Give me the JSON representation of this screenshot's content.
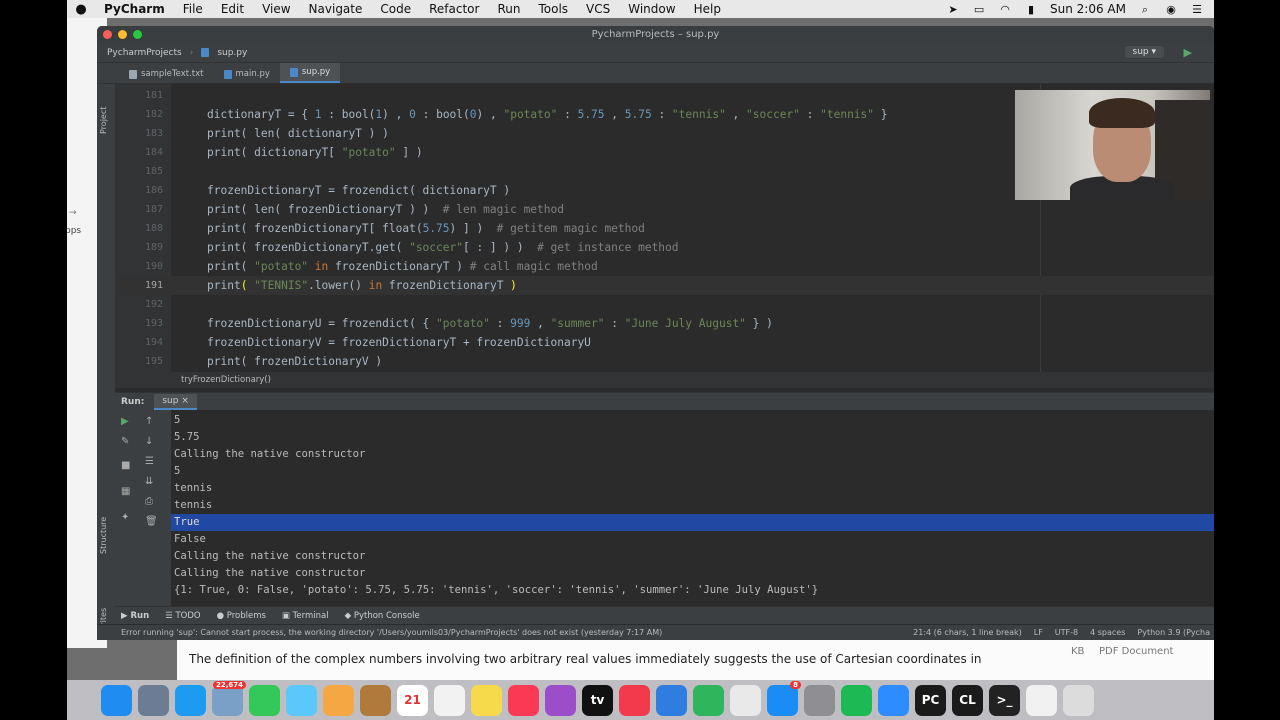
{
  "menubar": {
    "apple": "",
    "app": "PyCharm",
    "items": [
      "File",
      "Edit",
      "View",
      "Navigate",
      "Code",
      "Refactor",
      "Run",
      "Tools",
      "VCS",
      "Window",
      "Help"
    ],
    "clock": "Sun 2:06 AM"
  },
  "bg_browser": {
    "text1": "",
    "text2": "pps"
  },
  "window": {
    "title": "PycharmProjects – sup.py"
  },
  "navbar": {
    "project": "PycharmProjects",
    "file": "sup.py",
    "run_config": "sup"
  },
  "tabs": [
    {
      "label": "sampleText.txt",
      "color": "#9aa7b0"
    },
    {
      "label": "main.py",
      "color": "#4a88c7"
    },
    {
      "label": "sup.py",
      "color": "#4a88c7"
    }
  ],
  "side_labels": {
    "project": "Project",
    "structure": "Structure",
    "favorites": "Favorites"
  },
  "editor": {
    "lines": [
      {
        "n": "181",
        "code": [
          {
            "t": "",
            "c": ""
          }
        ]
      },
      {
        "n": "182",
        "code": [
          {
            "t": "dictionaryT = { ",
            "c": ""
          },
          {
            "t": "1",
            "c": "num"
          },
          {
            "t": " : bool(",
            "c": ""
          },
          {
            "t": "1",
            "c": "num"
          },
          {
            "t": ") , ",
            "c": ""
          },
          {
            "t": "0",
            "c": "num"
          },
          {
            "t": " : bool(",
            "c": ""
          },
          {
            "t": "0",
            "c": "num"
          },
          {
            "t": ") , ",
            "c": ""
          },
          {
            "t": "\"potato\"",
            "c": "str"
          },
          {
            "t": " : ",
            "c": ""
          },
          {
            "t": "5.75",
            "c": "num"
          },
          {
            "t": " , ",
            "c": ""
          },
          {
            "t": "5.75",
            "c": "num"
          },
          {
            "t": " : ",
            "c": ""
          },
          {
            "t": "\"tennis\"",
            "c": "str"
          },
          {
            "t": " , ",
            "c": ""
          },
          {
            "t": "\"soccer\"",
            "c": "str"
          },
          {
            "t": " : ",
            "c": ""
          },
          {
            "t": "\"tennis\"",
            "c": "str"
          },
          {
            "t": " }",
            "c": ""
          }
        ]
      },
      {
        "n": "183",
        "code": [
          {
            "t": "print( len( dictionaryT ) )",
            "c": ""
          }
        ]
      },
      {
        "n": "184",
        "code": [
          {
            "t": "print( dictionaryT[ ",
            "c": ""
          },
          {
            "t": "\"potato\"",
            "c": "str"
          },
          {
            "t": " ] )",
            "c": ""
          }
        ]
      },
      {
        "n": "185",
        "code": [
          {
            "t": "",
            "c": ""
          }
        ]
      },
      {
        "n": "186",
        "code": [
          {
            "t": "frozenDictionaryT = frozendict( dictionaryT )",
            "c": ""
          }
        ]
      },
      {
        "n": "187",
        "code": [
          {
            "t": "print( len( frozenDictionaryT ) )  ",
            "c": ""
          },
          {
            "t": "# len magic method",
            "c": "com"
          }
        ]
      },
      {
        "n": "188",
        "code": [
          {
            "t": "print( frozenDictionaryT[ ",
            "c": ""
          },
          {
            "t": "float",
            "c": "fn"
          },
          {
            "t": "(",
            "c": ""
          },
          {
            "t": "5.75",
            "c": "num"
          },
          {
            "t": ") ] )  ",
            "c": ""
          },
          {
            "t": "# getitem magic method",
            "c": "com"
          }
        ]
      },
      {
        "n": "189",
        "code": [
          {
            "t": "print( frozenDictionaryT.get( ",
            "c": ""
          },
          {
            "t": "\"soccer\"",
            "c": "str"
          },
          {
            "t": "[ : ] ) )  ",
            "c": ""
          },
          {
            "t": "# get instance method",
            "c": "com"
          }
        ]
      },
      {
        "n": "190",
        "code": [
          {
            "t": "print( ",
            "c": ""
          },
          {
            "t": "\"potato\"",
            "c": "str"
          },
          {
            "t": " ",
            "c": ""
          },
          {
            "t": "in",
            "c": "kw"
          },
          {
            "t": " frozenDictionaryT )",
            "c": ""
          },
          {
            "t": " # call magic method",
            "c": "com"
          }
        ]
      },
      {
        "n": "191",
        "code": [
          {
            "t": "print",
            "c": ""
          },
          {
            "t": "(",
            "c": "brk"
          },
          {
            "t": " ",
            "c": ""
          },
          {
            "t": "\"TENNIS\"",
            "c": "str"
          },
          {
            "t": ".lower() ",
            "c": ""
          },
          {
            "t": "in",
            "c": "kw"
          },
          {
            "t": " frozenDictionaryT ",
            "c": ""
          },
          {
            "t": ")",
            "c": "brk"
          }
        ],
        "current": true
      },
      {
        "n": "192",
        "code": [
          {
            "t": "",
            "c": ""
          }
        ]
      },
      {
        "n": "193",
        "code": [
          {
            "t": "frozenDictionaryU = frozendict( { ",
            "c": ""
          },
          {
            "t": "\"potato\"",
            "c": "str"
          },
          {
            "t": " : ",
            "c": ""
          },
          {
            "t": "999",
            "c": "num"
          },
          {
            "t": " , ",
            "c": ""
          },
          {
            "t": "\"summer\"",
            "c": "str"
          },
          {
            "t": " : ",
            "c": ""
          },
          {
            "t": "\"June July August\"",
            "c": "str"
          },
          {
            "t": " } )",
            "c": ""
          }
        ]
      },
      {
        "n": "194",
        "code": [
          {
            "t": "frozenDictionaryV = frozenDictionaryT + frozenDictionaryU",
            "c": ""
          }
        ]
      },
      {
        "n": "195",
        "code": [
          {
            "t": "print( frozenDictionaryV )",
            "c": ""
          }
        ]
      }
    ],
    "breadcrumb": "tryFrozenDictionary()"
  },
  "run": {
    "label": "Run:",
    "tab": "sup",
    "output": [
      "5",
      "5.75",
      "Calling the native constructor",
      "5",
      "tennis",
      "tennis",
      "True",
      "False",
      "Calling the native constructor",
      "Calling the native constructor",
      "{1: True, 0: False, 'potato': 5.75, 5.75: 'tennis', 'soccer': 'tennis', 'summer': 'June July August'}"
    ],
    "selected_index": 6
  },
  "bottom_tools": [
    "Run",
    "TODO",
    "Problems",
    "Terminal",
    "Python Console"
  ],
  "status": {
    "message": "Error running 'sup': Cannot start process, the working directory '/Users/youmils03/PycharmProjects' does not exist (yesterday 7:17 AM)",
    "position": "21:4 (6 chars, 1 line break)",
    "line_sep": "LF",
    "encoding": "UTF-8",
    "indent": "4 spaces",
    "interpreter": "Python 3.9 (Pycha"
  },
  "bg_document": {
    "text": "The definition of the complex numbers involving two arbitrary real values immediately suggests the use of Cartesian coordinates in",
    "kb": "KB",
    "pdf": "PDF Document"
  },
  "dock": [
    {
      "name": "finder",
      "label": "",
      "color": "#1e8cf0"
    },
    {
      "name": "launchpad",
      "label": "",
      "color": "#6b7c93"
    },
    {
      "name": "safari",
      "label": "",
      "color": "#1d9bf0"
    },
    {
      "name": "preview",
      "label": "",
      "color": "#7aa0c8",
      "badge": "22,674"
    },
    {
      "name": "facetime",
      "label": "",
      "color": "#34c759"
    },
    {
      "name": "messages",
      "label": "",
      "color": "#5ac8fa"
    },
    {
      "name": "photos",
      "label": "",
      "color": "#f4a742"
    },
    {
      "name": "notes-book",
      "label": "",
      "color": "#b07a3a"
    },
    {
      "name": "calendar",
      "label": "21",
      "color": "#ffffff",
      "text": "#d33"
    },
    {
      "name": "reminders",
      "label": "",
      "color": "#f2f2f2"
    },
    {
      "name": "stickies",
      "label": "",
      "color": "#f7d94c"
    },
    {
      "name": "music",
      "label": "",
      "color": "#fa3a55"
    },
    {
      "name": "podcasts",
      "label": "",
      "color": "#9b4dca"
    },
    {
      "name": "apple-tv",
      "label": "tv",
      "color": "#111111"
    },
    {
      "name": "news",
      "label": "",
      "color": "#f23a4b"
    },
    {
      "name": "keynote",
      "label": "",
      "color": "#2f7de1"
    },
    {
      "name": "numbers",
      "label": "",
      "color": "#2fb55b"
    },
    {
      "name": "chrome",
      "label": "",
      "color": "#e9e9e9"
    },
    {
      "name": "app-store",
      "label": "",
      "color": "#1a8cf5",
      "badge": "8"
    },
    {
      "name": "system-preferences",
      "label": "",
      "color": "#8e8e93"
    },
    {
      "name": "spotify",
      "label": "",
      "color": "#1db954"
    },
    {
      "name": "zoom",
      "label": "",
      "color": "#2d8cff"
    },
    {
      "name": "pycharm",
      "label": "PC",
      "color": "#1a1a1a"
    },
    {
      "name": "clion",
      "label": "CL",
      "color": "#1a1a1a"
    },
    {
      "name": "terminal",
      "label": ">_",
      "color": "#222222"
    },
    {
      "name": "document",
      "label": "",
      "color": "#f0f0f0"
    },
    {
      "name": "trash",
      "label": "",
      "color": "#dcdcdc"
    }
  ]
}
